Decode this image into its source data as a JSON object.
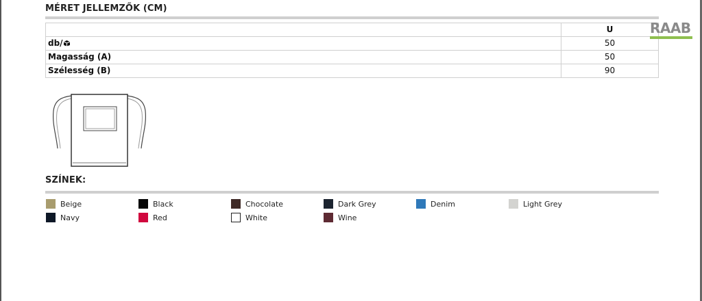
{
  "size_section": {
    "title": "MÉRET JELLEMZŐK (CM)",
    "column_header": "U",
    "rows": [
      {
        "label": "db/",
        "icon": "box-icon",
        "value": "50"
      },
      {
        "label": "Magasság (A)",
        "value": "50"
      },
      {
        "label": "Szélesség (B)",
        "value": "90"
      }
    ]
  },
  "logo": {
    "text": "RAAB",
    "accent": "#8fbf4f"
  },
  "colors_section": {
    "title": "SZÍNEK:",
    "items": [
      {
        "name": "Beige",
        "hex": "#a89c6e"
      },
      {
        "name": "Black",
        "hex": "#050505"
      },
      {
        "name": "Chocolate",
        "hex": "#3f2a26"
      },
      {
        "name": "Dark Grey",
        "hex": "#1c2430"
      },
      {
        "name": "Denim",
        "hex": "#2f79b9"
      },
      {
        "name": "Light Grey",
        "hex": "#d3d3d0"
      },
      {
        "name": "Navy",
        "hex": "#0e1827"
      },
      {
        "name": "Red",
        "hex": "#d0083e"
      },
      {
        "name": "White",
        "hex": "#ffffff"
      },
      {
        "name": "Wine",
        "hex": "#5e2a33"
      }
    ]
  }
}
